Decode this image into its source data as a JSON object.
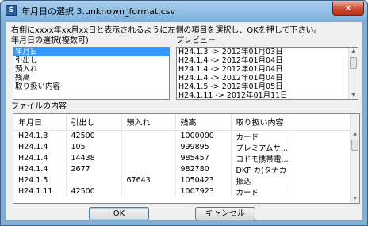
{
  "window": {
    "title": "年月日の選択 3.unknown_format.csv",
    "app_icon_glyph": "S",
    "close_glyph": "✕"
  },
  "instructions": "右側にxxxx年xx月xx日と表示されるように左側の項目を選択し、OKを押して下さい。",
  "left_list": {
    "label": "年月日の選択(複数可)",
    "items": [
      {
        "label": "年月日",
        "selected": true
      },
      {
        "label": "引出し",
        "selected": false
      },
      {
        "label": "預入れ",
        "selected": false
      },
      {
        "label": "残高",
        "selected": false
      },
      {
        "label": "取り扱い内容",
        "selected": false
      }
    ]
  },
  "preview": {
    "label": "プレビュー",
    "items": [
      "H24.1.3 -> 2012年01月03日",
      "H24.1.4 -> 2012年01月04日",
      "H24.1.4 -> 2012年01月04日",
      "H24.1.4 -> 2012年01月04日",
      "H24.1.5 -> 2012年01月05日",
      "H24.1.11 -> 2012年01月11日"
    ]
  },
  "file_contents": {
    "label": "ファイルの内容",
    "columns": [
      "年月日",
      "引出し",
      "預入れ",
      "残高",
      "取り扱い内容"
    ],
    "rows": [
      [
        "H24.1.3",
        "42500",
        "",
        "1000000",
        "カード"
      ],
      [
        "H24.1.4",
        "105",
        "",
        "999895",
        "プレミアムサ..."
      ],
      [
        "H24.1.4",
        "14438",
        "",
        "985457",
        "コドモ携帯電..."
      ],
      [
        "H24.1.4",
        "2677",
        "",
        "982780",
        "DKF カ)タナカ"
      ],
      [
        "H24.1.5",
        "",
        "67643",
        "1050423",
        "振込"
      ],
      [
        "H24.1.11",
        "42500",
        "",
        "1007923",
        "カード"
      ]
    ]
  },
  "buttons": {
    "ok": "OK",
    "cancel": "キャンセル"
  },
  "colors": {
    "selection": "#3399ff",
    "window_frame": "#7fb0d8",
    "close_button": "#c9452a"
  }
}
